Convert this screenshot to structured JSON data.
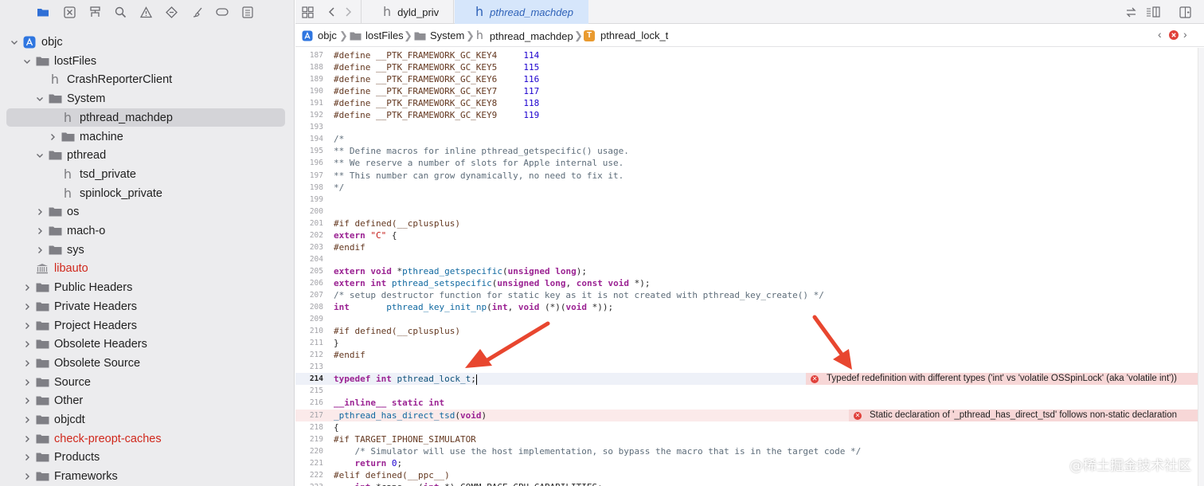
{
  "sidebar": {
    "toolbar_icons": [
      "folder-icon",
      "x-square-icon",
      "hierarchy-icon",
      "search-icon",
      "warning-icon",
      "diamond-icon",
      "brush-icon",
      "tag-icon",
      "list-icon"
    ],
    "tree": [
      {
        "label": "objc",
        "kind": "project",
        "level": 0,
        "disclosure": "open"
      },
      {
        "label": "lostFiles",
        "kind": "folder",
        "level": 1,
        "disclosure": "open"
      },
      {
        "label": "CrashReporterClient",
        "kind": "header",
        "level": 2,
        "disclosure": "none"
      },
      {
        "label": "System",
        "kind": "folder",
        "level": 2,
        "disclosure": "open"
      },
      {
        "label": "pthread_machdep",
        "kind": "header",
        "level": 3,
        "disclosure": "none",
        "selected": true
      },
      {
        "label": "machine",
        "kind": "folder",
        "level": 3,
        "disclosure": "closed"
      },
      {
        "label": "pthread",
        "kind": "folder",
        "level": 2,
        "disclosure": "open"
      },
      {
        "label": "tsd_private",
        "kind": "header",
        "level": 3,
        "disclosure": "none"
      },
      {
        "label": "spinlock_private",
        "kind": "header",
        "level": 3,
        "disclosure": "none"
      },
      {
        "label": "os",
        "kind": "folder",
        "level": 2,
        "disclosure": "closed"
      },
      {
        "label": "mach-o",
        "kind": "folder",
        "level": 2,
        "disclosure": "closed"
      },
      {
        "label": "sys",
        "kind": "folder",
        "level": 2,
        "disclosure": "closed"
      },
      {
        "label": "libauto",
        "kind": "library",
        "level": 1,
        "disclosure": "none",
        "red": true
      },
      {
        "label": "Public Headers",
        "kind": "folder",
        "level": 1,
        "disclosure": "closed"
      },
      {
        "label": "Private Headers",
        "kind": "folder",
        "level": 1,
        "disclosure": "closed"
      },
      {
        "label": "Project Headers",
        "kind": "folder",
        "level": 1,
        "disclosure": "closed"
      },
      {
        "label": "Obsolete Headers",
        "kind": "folder",
        "level": 1,
        "disclosure": "closed"
      },
      {
        "label": "Obsolete Source",
        "kind": "folder",
        "level": 1,
        "disclosure": "closed"
      },
      {
        "label": "Source",
        "kind": "folder",
        "level": 1,
        "disclosure": "closed"
      },
      {
        "label": "Other",
        "kind": "folder",
        "level": 1,
        "disclosure": "closed"
      },
      {
        "label": "objcdt",
        "kind": "folder",
        "level": 1,
        "disclosure": "closed"
      },
      {
        "label": "check-preopt-caches",
        "kind": "folder",
        "level": 1,
        "disclosure": "closed",
        "red": true
      },
      {
        "label": "Products",
        "kind": "folder",
        "level": 1,
        "disclosure": "closed"
      },
      {
        "label": "Frameworks",
        "kind": "folder",
        "level": 1,
        "disclosure": "closed"
      }
    ]
  },
  "tabs": [
    {
      "label": "dyld_priv",
      "active": false
    },
    {
      "label": "pthread_machdep",
      "active": true
    }
  ],
  "breadcrumb": [
    {
      "label": "objc",
      "icon": "project-icon"
    },
    {
      "label": "lostFiles",
      "icon": "folder-icon"
    },
    {
      "label": "System",
      "icon": "folder-icon"
    },
    {
      "label": "pthread_machdep",
      "icon": "header-icon"
    },
    {
      "label": "pthread_lock_t",
      "icon": "typedef-icon"
    }
  ],
  "typedef_badge": "T",
  "code": {
    "lines": [
      {
        "n": "187",
        "t": [
          [
            "pp",
            "#define __PTK_FRAMEWORK_GC_KEY4     "
          ],
          [
            "num",
            "114"
          ]
        ]
      },
      {
        "n": "188",
        "t": [
          [
            "pp",
            "#define __PTK_FRAMEWORK_GC_KEY5     "
          ],
          [
            "num",
            "115"
          ]
        ]
      },
      {
        "n": "189",
        "t": [
          [
            "pp",
            "#define __PTK_FRAMEWORK_GC_KEY6     "
          ],
          [
            "num",
            "116"
          ]
        ]
      },
      {
        "n": "190",
        "t": [
          [
            "pp",
            "#define __PTK_FRAMEWORK_GC_KEY7     "
          ],
          [
            "num",
            "117"
          ]
        ]
      },
      {
        "n": "191",
        "t": [
          [
            "pp",
            "#define __PTK_FRAMEWORK_GC_KEY8     "
          ],
          [
            "num",
            "118"
          ]
        ]
      },
      {
        "n": "192",
        "t": [
          [
            "pp",
            "#define __PTK_FRAMEWORK_GC_KEY9     "
          ],
          [
            "num",
            "119"
          ]
        ]
      },
      {
        "n": "193",
        "t": []
      },
      {
        "n": "194",
        "t": [
          [
            "cm",
            "/*"
          ]
        ]
      },
      {
        "n": "195",
        "t": [
          [
            "cm",
            "** Define macros for inline pthread_getspecific() usage."
          ]
        ]
      },
      {
        "n": "196",
        "t": [
          [
            "cm",
            "** We reserve a number of slots for Apple internal use."
          ]
        ]
      },
      {
        "n": "197",
        "t": [
          [
            "cm",
            "** This number can grow dynamically, no need to fix it."
          ]
        ]
      },
      {
        "n": "198",
        "t": [
          [
            "cm",
            "*/"
          ]
        ]
      },
      {
        "n": "199",
        "t": []
      },
      {
        "n": "200",
        "t": []
      },
      {
        "n": "201",
        "t": [
          [
            "pp",
            "#if defined(__cplusplus)"
          ]
        ]
      },
      {
        "n": "202",
        "t": [
          [
            "kw",
            "extern"
          ],
          [
            "",
            " "
          ],
          [
            "str",
            "\"C\""
          ],
          [
            "",
            " {"
          ]
        ]
      },
      {
        "n": "203",
        "t": [
          [
            "pp",
            "#endif"
          ]
        ]
      },
      {
        "n": "204",
        "t": []
      },
      {
        "n": "205",
        "t": [
          [
            "kw",
            "extern"
          ],
          [
            "",
            " "
          ],
          [
            "kw",
            "void"
          ],
          [
            "",
            " *"
          ],
          [
            "fn",
            "pthread_getspecific"
          ],
          [
            "",
            "("
          ],
          [
            "kw",
            "unsigned"
          ],
          [
            "",
            " "
          ],
          [
            "kw",
            "long"
          ],
          [
            "",
            ");"
          ]
        ]
      },
      {
        "n": "206",
        "t": [
          [
            "kw",
            "extern"
          ],
          [
            "",
            " "
          ],
          [
            "kw",
            "int"
          ],
          [
            "",
            " "
          ],
          [
            "fn",
            "pthread_setspecific"
          ],
          [
            "",
            "("
          ],
          [
            "kw",
            "unsigned"
          ],
          [
            "",
            " "
          ],
          [
            "kw",
            "long"
          ],
          [
            "",
            ", "
          ],
          [
            "kw",
            "const"
          ],
          [
            "",
            " "
          ],
          [
            "kw",
            "void"
          ],
          [
            "",
            " *);"
          ]
        ]
      },
      {
        "n": "207",
        "t": [
          [
            "cm",
            "/* setup destructor function for static key as it is not created with pthread_key_create() */"
          ]
        ]
      },
      {
        "n": "208",
        "t": [
          [
            "kw",
            "int"
          ],
          [
            "",
            "       "
          ],
          [
            "fn",
            "pthread_key_init_np"
          ],
          [
            "",
            "("
          ],
          [
            "kw",
            "int"
          ],
          [
            "",
            ", "
          ],
          [
            "kw",
            "void"
          ],
          [
            "",
            " (*)("
          ],
          [
            "kw",
            "void"
          ],
          [
            "",
            " *));"
          ]
        ]
      },
      {
        "n": "209",
        "t": []
      },
      {
        "n": "210",
        "t": [
          [
            "pp",
            "#if defined(__cplusplus)"
          ]
        ]
      },
      {
        "n": "211",
        "t": [
          [
            "",
            "}"
          ]
        ]
      },
      {
        "n": "212",
        "t": [
          [
            "pp",
            "#endif"
          ]
        ]
      },
      {
        "n": "213",
        "t": []
      },
      {
        "n": "214",
        "t": [
          [
            "kw",
            "typedef"
          ],
          [
            "",
            " "
          ],
          [
            "kw",
            "int"
          ],
          [
            "",
            " "
          ],
          [
            "ty",
            "pthread_lock_t"
          ],
          [
            "",
            ";"
          ]
        ],
        "current": true,
        "caret": true,
        "error": "Typedef redefinition with different types ('int' vs 'volatile OSSpinLock' (aka 'volatile int'))"
      },
      {
        "n": "215",
        "t": []
      },
      {
        "n": "216",
        "t": [
          [
            "kw",
            "__inline__"
          ],
          [
            "",
            " "
          ],
          [
            "kw",
            "static"
          ],
          [
            "",
            " "
          ],
          [
            "kw",
            "int"
          ]
        ]
      },
      {
        "n": "217",
        "t": [
          [
            "fn",
            "_pthread_has_direct_tsd"
          ],
          [
            "",
            "("
          ],
          [
            "kw",
            "void"
          ],
          [
            "",
            ")"
          ]
        ],
        "errline": true,
        "error": "Static declaration of '_pthread_has_direct_tsd' follows non-static declaration"
      },
      {
        "n": "218",
        "t": [
          [
            "",
            "{"
          ]
        ]
      },
      {
        "n": "219",
        "t": [
          [
            "pp",
            "#if TARGET_IPHONE_SIMULATOR"
          ]
        ]
      },
      {
        "n": "220",
        "t": [
          [
            "",
            "    "
          ],
          [
            "cm",
            "/* Simulator will use the host implementation, so bypass the macro that is in the target code */"
          ]
        ]
      },
      {
        "n": "221",
        "t": [
          [
            "",
            "    "
          ],
          [
            "kw",
            "return"
          ],
          [
            "",
            " "
          ],
          [
            "num",
            "0"
          ],
          [
            "",
            ";"
          ]
        ]
      },
      {
        "n": "222",
        "t": [
          [
            "pp",
            "#elif defined(__ppc__)"
          ]
        ]
      },
      {
        "n": "223",
        "t": [
          [
            "",
            "    "
          ],
          [
            "kw",
            "int"
          ],
          [
            "",
            " *caps = ("
          ],
          [
            "kw",
            "int"
          ],
          [
            "",
            " *)_COMM_PAGE_CPU_CAPABILITIES;"
          ]
        ]
      }
    ]
  },
  "watermark": "@稀土掘金技术社区",
  "colors": {
    "accent": "#2f62b8",
    "error": "#e0403a",
    "arrow": "#e8462f"
  }
}
